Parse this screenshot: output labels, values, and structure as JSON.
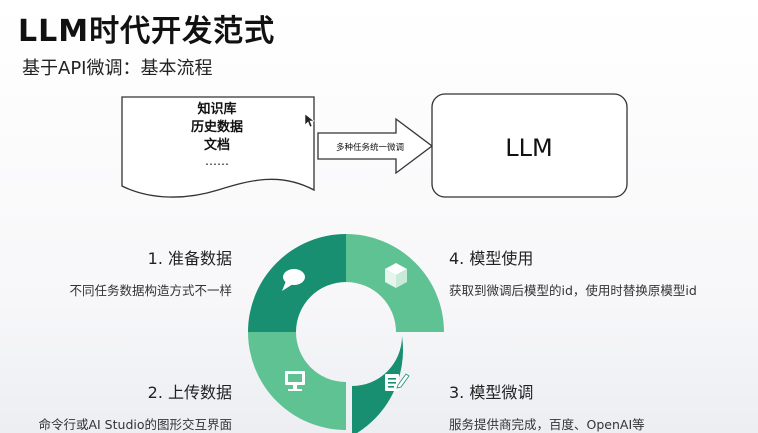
{
  "header": {
    "title": "LLM时代开发范式",
    "subtitle": "基于API微调：基本流程"
  },
  "flow": {
    "document_lines": [
      "知识库",
      "历史数据",
      "文档",
      "……"
    ],
    "arrow_label": "多种任务统一微调",
    "model_label": "LLM"
  },
  "steps": [
    {
      "title": "1. 准备数据",
      "description": "不同任务数据构造方式不一样",
      "icon": "speech-bubble-icon"
    },
    {
      "title": "2. 上传数据",
      "description": "命令行或AI Studio的图形交互界面",
      "icon": "monitor-icon"
    },
    {
      "title": "3. 模型微调",
      "description": "服务提供商完成，百度、OpenAI等",
      "icon": "edit-note-icon"
    },
    {
      "title": "4. 模型使用",
      "description": "获取到微调后模型的id，使用时替换原模型id",
      "icon": "box-icon"
    }
  ],
  "colors": {
    "dark_green": "#178f70",
    "light_green": "#5fc293",
    "icon": "#ffffff"
  }
}
